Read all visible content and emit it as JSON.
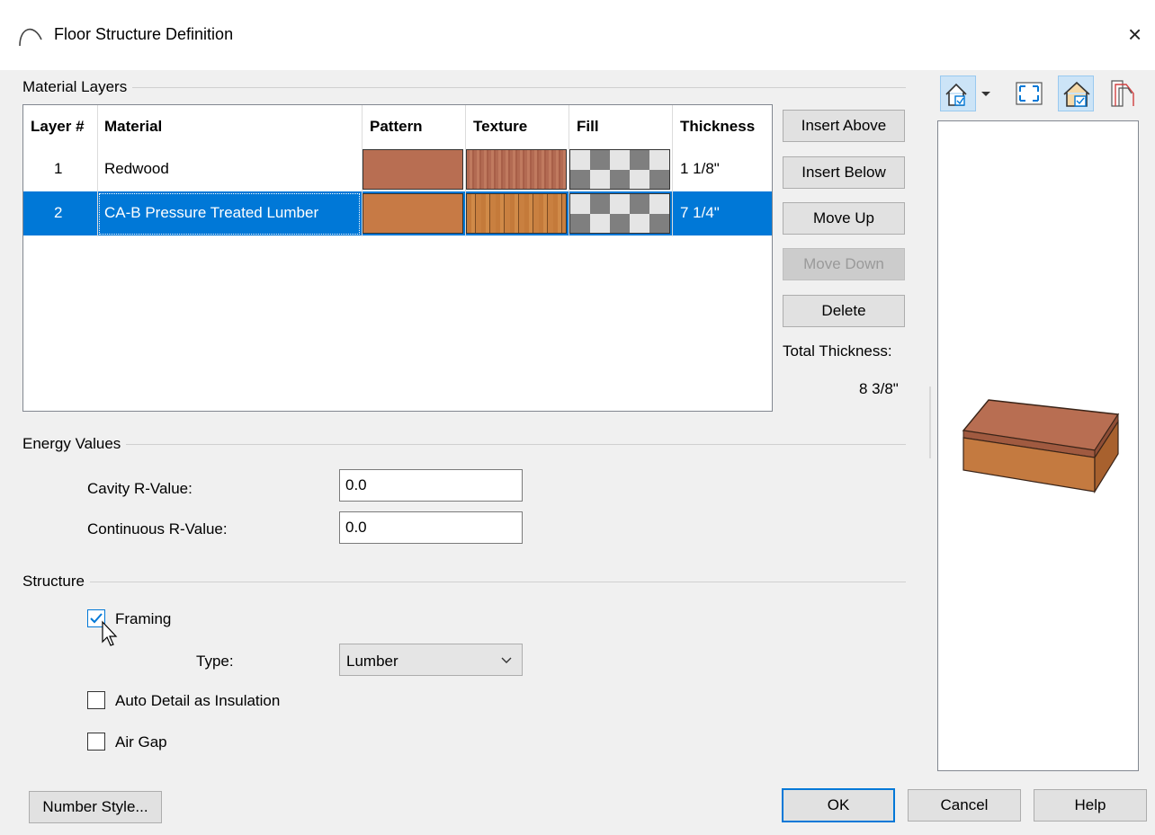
{
  "window": {
    "title": "Floor Structure Definition",
    "close": "×"
  },
  "material_layers": {
    "group_label": "Material Layers",
    "columns": [
      "Layer #",
      "Material",
      "Pattern",
      "Texture",
      "Fill",
      "Thickness"
    ],
    "rows": [
      {
        "layer": "1",
        "material": "Redwood",
        "thickness": "1 1/8\"",
        "selected": false
      },
      {
        "layer": "2",
        "material": "CA-B Pressure Treated Lumber",
        "thickness": "7 1/4\"",
        "selected": true
      }
    ],
    "buttons": {
      "insert_above": "Insert Above",
      "insert_below": "Insert Below",
      "move_up": "Move Up",
      "move_down": "Move Down",
      "delete": "Delete"
    },
    "total_thickness_label": "Total Thickness:",
    "total_thickness_value": "8 3/8\""
  },
  "energy": {
    "group_label": "Energy Values",
    "cavity_label": "Cavity R-Value:",
    "cavity_value": "0.0",
    "continuous_label": "Continuous R-Value:",
    "continuous_value": "0.0"
  },
  "structure": {
    "group_label": "Structure",
    "framing_label": "Framing",
    "framing_checked": true,
    "type_label": "Type:",
    "type_value": "Lumber",
    "auto_detail_label": "Auto Detail as Insulation",
    "auto_detail_checked": false,
    "air_gap_label": "Air Gap",
    "air_gap_checked": false
  },
  "footer": {
    "number_style": "Number Style...",
    "ok": "OK",
    "cancel": "Cancel",
    "help": "Help"
  },
  "colors": {
    "selection": "#0078d7",
    "redwood": "#b86e52",
    "lumber": "#c77a45"
  },
  "preview_toolbar": [
    "view-options-icon",
    "fill-window-icon",
    "show-materials-icon",
    "layers-icon"
  ]
}
